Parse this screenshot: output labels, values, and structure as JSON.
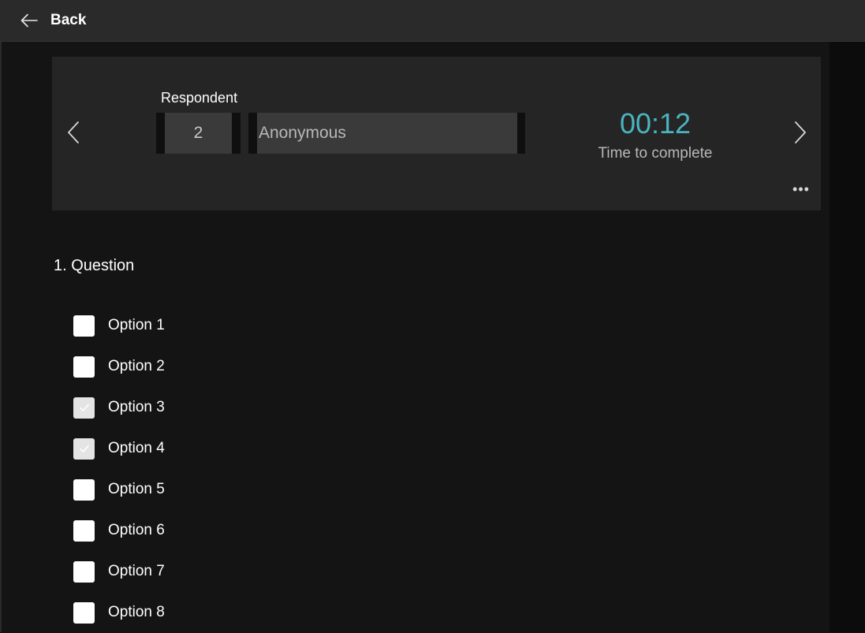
{
  "header": {
    "back_label": "Back"
  },
  "respondent": {
    "label": "Respondent",
    "number": "2",
    "name": "Anonymous"
  },
  "timing": {
    "value": "00:12",
    "label": "Time to complete"
  },
  "more_menu_glyph": "•••",
  "question": {
    "title": "1. Question",
    "options": [
      {
        "label": "Option 1",
        "checked": false
      },
      {
        "label": "Option 2",
        "checked": false
      },
      {
        "label": "Option 3",
        "checked": true
      },
      {
        "label": "Option 4",
        "checked": true
      },
      {
        "label": "Option 5",
        "checked": false
      },
      {
        "label": "Option 6",
        "checked": false
      },
      {
        "label": "Option 7",
        "checked": false
      },
      {
        "label": "Option 8",
        "checked": false
      }
    ]
  },
  "colors": {
    "accent_time": "#4bb3c0",
    "background": "#141414",
    "card": "#252525"
  }
}
